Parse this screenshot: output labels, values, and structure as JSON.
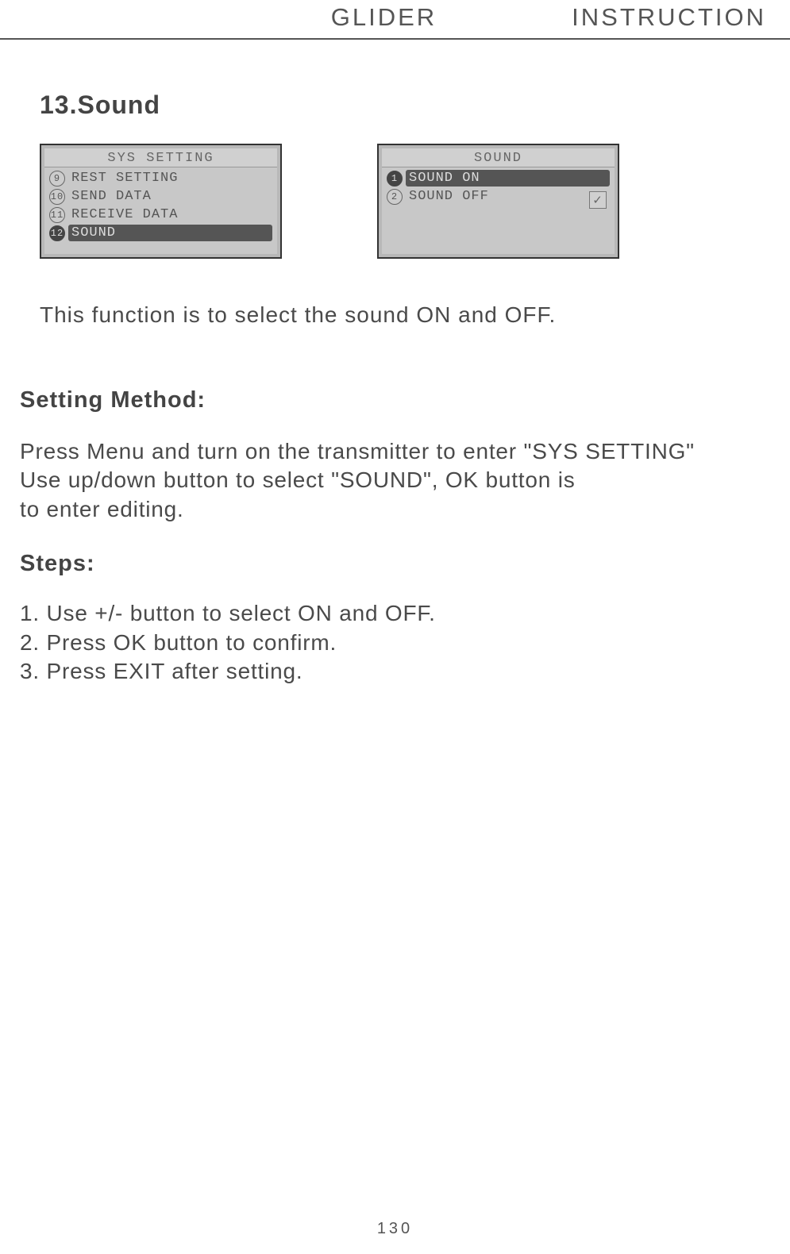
{
  "header": {
    "left": "GLIDER",
    "right": "INSTRUCTION"
  },
  "section_title": "13.Sound",
  "screens": {
    "left": {
      "title": "SYS SETTING",
      "items": [
        {
          "num": "9",
          "label": "REST SETTING",
          "selected": false
        },
        {
          "num": "10",
          "label": "SEND DATA",
          "selected": false
        },
        {
          "num": "11",
          "label": "RECEIVE DATA",
          "selected": false
        },
        {
          "num": "12",
          "label": "SOUND",
          "selected": true
        }
      ]
    },
    "right": {
      "title": "SOUND",
      "items": [
        {
          "num": "1",
          "label": "SOUND ON",
          "selected": true
        },
        {
          "num": "2",
          "label": "SOUND OFF",
          "selected": false
        }
      ]
    }
  },
  "intro": "This function is to select the sound ON and OFF.",
  "setting_heading": "Setting Method:",
  "setting_body_line1": "Press Menu and turn on the transmitter to enter \"SYS SETTING\"",
  "setting_body_line2": "Use up/down button to select \"SOUND\", OK button is",
  "setting_body_line3": "to enter editing.",
  "steps_heading": "Steps:",
  "steps": {
    "s1": "1. Use +/- button to select ON and OFF.",
    "s2": "2. Press OK button to confirm.",
    "s3": "3. Press EXIT after setting."
  },
  "page_number": "130"
}
